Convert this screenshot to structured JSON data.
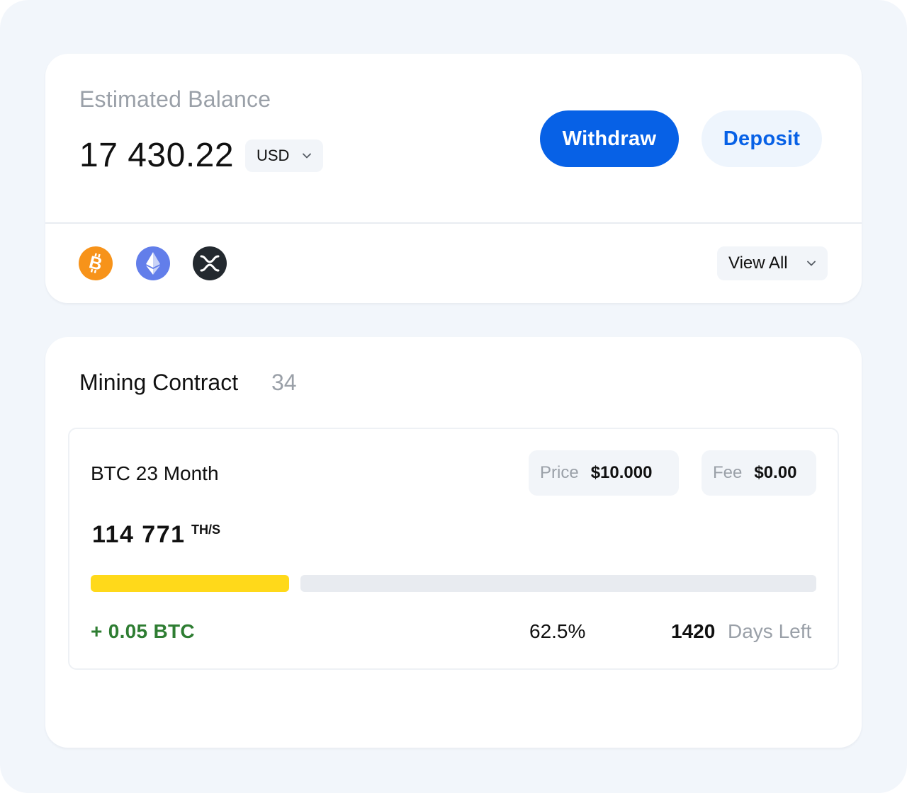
{
  "colors": {
    "page_background": "#f2f6fb",
    "accent_blue": "#0761e6",
    "progress_fill": "#ffd91a",
    "earned_green": "#2e7d32",
    "muted_text": "#9aa0a8"
  },
  "balance": {
    "label": "Estimated Balance",
    "amount": "17 430.22",
    "currency": "USD",
    "withdraw_label": "Withdraw",
    "deposit_label": "Deposit"
  },
  "coins": [
    {
      "icon": "bitcoin-icon",
      "color": "#f7931a"
    },
    {
      "icon": "ethereum-icon",
      "color": "#627eea"
    },
    {
      "icon": "xrp-icon",
      "color": "#23292f"
    }
  ],
  "view_all_label": "View All",
  "mining": {
    "title": "Mining Contract",
    "count": "34",
    "contract": {
      "name": "BTC 23 Month",
      "price_label": "Price",
      "price_value": "$10.000",
      "fee_label": "Fee",
      "fee_value": "$0.00",
      "hashrate": "114 771",
      "hashrate_unit": "TH/S",
      "progress_fraction": 0.27,
      "earned": "+ 0.05 BTC",
      "percent": "62.5%",
      "days_left_number": "1420",
      "days_left_label": "Days Left"
    }
  }
}
